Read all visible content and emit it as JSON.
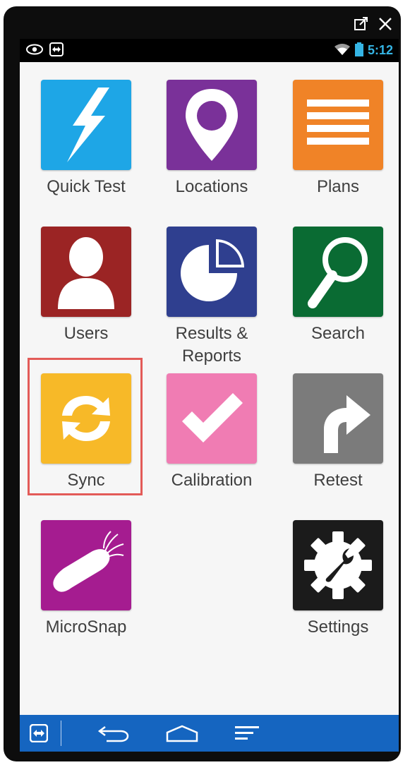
{
  "window": {
    "icons": [
      "external-open-icon",
      "close-icon"
    ]
  },
  "statusbar": {
    "time": "5:12",
    "left_icons": [
      "eye-icon",
      "teamviewer-icon"
    ],
    "right_icons": [
      "wifi-icon",
      "battery-icon"
    ]
  },
  "apps": [
    {
      "key": "quick-test",
      "label": "Quick Test",
      "color": "#1ea6e6",
      "icon": "lightning-icon"
    },
    {
      "key": "locations",
      "label": "Locations",
      "color": "#7a3199",
      "icon": "map-pin-icon"
    },
    {
      "key": "plans",
      "label": "Plans",
      "color": "#f08327",
      "icon": "list-lines-icon"
    },
    {
      "key": "users",
      "label": "Users",
      "color": "#9b2424",
      "icon": "user-icon"
    },
    {
      "key": "results-reports",
      "label": "Results &",
      "label2": "Reports",
      "color": "#2f3f8f",
      "icon": "pie-chart-icon"
    },
    {
      "key": "search",
      "label": "Search",
      "color": "#0a6b33",
      "icon": "magnifier-icon"
    },
    {
      "key": "sync",
      "label": "Sync",
      "color": "#f7b928",
      "icon": "sync-icon"
    },
    {
      "key": "calibration",
      "label": "Calibration",
      "color": "#f07cb3",
      "icon": "checkmark-icon"
    },
    {
      "key": "retest",
      "label": "Retest",
      "color": "#7b7b7b",
      "icon": "redo-arrow-icon"
    },
    {
      "key": "microsnap",
      "label": "MicroSnap",
      "color": "#a51c90",
      "icon": "bacteria-icon"
    },
    {
      "key": "settings",
      "label": "Settings",
      "color": "#1b1b1b",
      "icon": "gear-wrench-icon"
    }
  ],
  "highlight": {
    "target": "sync"
  },
  "navbar": {
    "icons": [
      "teamviewer-icon",
      "back-icon",
      "home-icon",
      "menu-icon"
    ],
    "accent": "#1565c0"
  }
}
